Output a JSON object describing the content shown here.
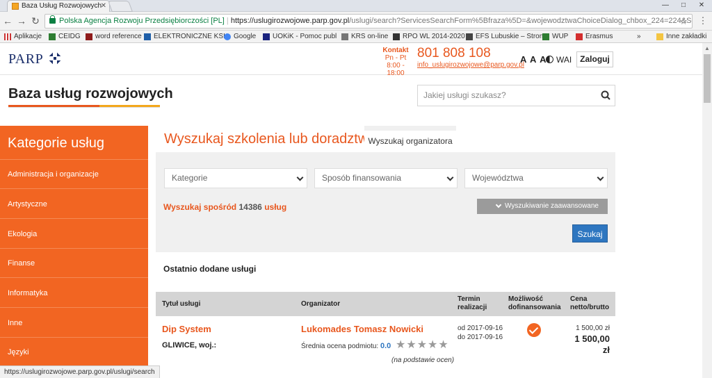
{
  "browser": {
    "tab_title": "Baza Usług Rozwojowych",
    "url_security_label": "Polska Agencja Rozwoju Przedsiębiorczości [PL]",
    "url_host": "https://uslugirozwojowe.parp.gov.pl",
    "url_path": "/uslugi/search?ServicesSearchForm%5Bfraza%5D=&wojewodztwaChoiceDialog_chbox_224=224&Servi...",
    "bookmarks": [
      "Aplikacje",
      "CEIDG",
      "word reference",
      "ELEKTRONICZNE KSI",
      "Google",
      "UOKiK - Pomoc publ",
      "KRS on-line",
      "RPO WL 2014-2020",
      "EFS Lubuskie – Stron",
      "WUP",
      "Erasmus",
      "Inne zakładki"
    ],
    "bookmark_more": "»",
    "status_url": "https://uslugirozwojowe.parp.gov.pl/uslugi/search"
  },
  "header": {
    "logo": "PARP",
    "kontakt_label": "Kontakt",
    "kontakt_days": "Pn - Pt",
    "kontakt_hours": "8:00 - 18:00",
    "phone": "801 808 108",
    "email": "info_uslugirozwojowe@parp.gov.pl",
    "font_size_label": "A A A",
    "wai_label": "WAI",
    "login_label": "Zaloguj",
    "brand_title": "Baza usług rozwojowych",
    "search_placeholder": "Jakiej usługi szukasz?"
  },
  "sidebar": {
    "title": "Kategorie usług",
    "items": [
      {
        "label": "Administracja i organizacje"
      },
      {
        "label": "Artystyczne"
      },
      {
        "label": "Ekologia"
      },
      {
        "label": "Finanse"
      },
      {
        "label": "Informatyka"
      },
      {
        "label": "Inne"
      },
      {
        "label": "Języki"
      }
    ]
  },
  "main": {
    "title": "Wyszukaj szkolenia lub doradztwo",
    "tab_organizer": "Wyszukaj organizatora",
    "filters": {
      "category": "Kategorie",
      "financing": "Sposób finansowania",
      "region": "Województwa"
    },
    "count_prefix": "Wyszukaj spośród",
    "count_value": "14386",
    "count_suffix": "usług",
    "advanced_label": "Wyszukiwanie zaawansowane",
    "search_button": "Szukaj",
    "recent_heading": "Ostatnio dodane usługi"
  },
  "table": {
    "headers": {
      "title": "Tytuł usługi",
      "organizer": "Organizator",
      "term": "Termin realizacji",
      "funding": "Możliwość dofinansowania",
      "price": "Cena netto/brutto"
    },
    "rows": [
      {
        "title": "Dip System",
        "city": "GLIWICE, woj.:",
        "organizer": "Lukomades Tomasz Nowicki",
        "rating_label": "Średnia ocena podmiotu:",
        "rating_value": "0.0",
        "rating_stars": 0,
        "rating_basis": "(na podstawie ocen)",
        "date_from": "od 2017-09-16",
        "date_to": "do 2017-09-16",
        "funding_available": true,
        "price_net": "1 500,00 zł",
        "price_gross": "1 500,00",
        "price_currency": "zł"
      }
    ]
  },
  "colors": {
    "accent": "#f26522",
    "accent_text": "#e8571e",
    "button_blue": "#2e76c0",
    "logo_navy": "#1b2f6b"
  }
}
